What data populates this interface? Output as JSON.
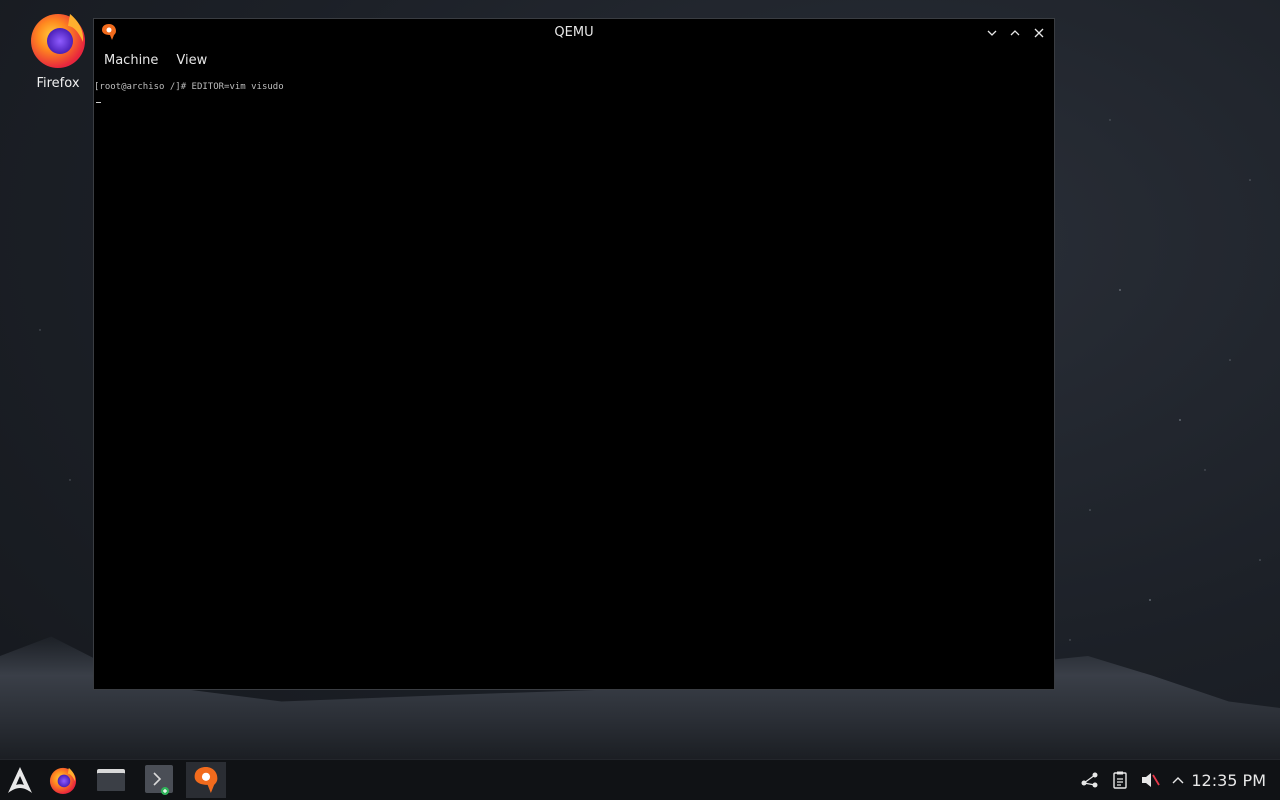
{
  "desktop": {
    "icons": [
      {
        "label": "Firefox",
        "icon": "firefox-icon"
      }
    ]
  },
  "window": {
    "title": "QEMU",
    "menus": [
      "Machine",
      "View"
    ],
    "console": {
      "prompt_line": "[root@archiso /]# EDITOR=vim visudo"
    },
    "controls": [
      "minimize-icon",
      "maximize-icon",
      "close-icon"
    ]
  },
  "taskbar": {
    "launcher_icon": "arch-linux-icon",
    "items": [
      "firefox-icon",
      "file-manager-icon",
      "terminal-icon",
      "qemu-icon"
    ],
    "tray_icons": [
      "network-icon",
      "clipboard-icon",
      "volume-muted-icon",
      "chevron-up-icon"
    ],
    "clock": "12:35 PM"
  },
  "colors": {
    "accent_orange": "#f26b1d",
    "window_bg": "#000000",
    "taskbar_bg": "#101215"
  }
}
